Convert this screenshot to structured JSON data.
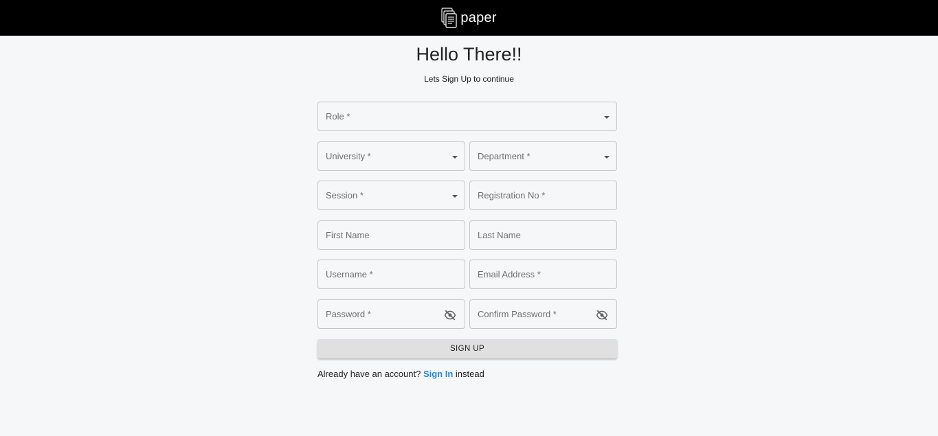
{
  "header": {
    "brand": "paper",
    "logo_icon": "document-stack-icon"
  },
  "hero": {
    "title": "Hello There!!",
    "subtitle": "Lets Sign Up to continue"
  },
  "form": {
    "role": {
      "label": "Role *",
      "value": ""
    },
    "university": {
      "label": "University *",
      "value": ""
    },
    "department": {
      "label": "Department *",
      "value": ""
    },
    "session": {
      "label": "Session *",
      "value": ""
    },
    "registration_no": {
      "label": "Registration No *",
      "value": ""
    },
    "first_name": {
      "label": "First Name",
      "value": ""
    },
    "last_name": {
      "label": "Last Name",
      "value": ""
    },
    "username": {
      "label": "Username *",
      "value": ""
    },
    "email": {
      "label": "Email Address *",
      "value": ""
    },
    "password": {
      "label": "Password *",
      "value": "",
      "toggle_icon": "eye-off-icon"
    },
    "confirm_password": {
      "label": "Confirm Password *",
      "value": "",
      "toggle_icon": "eye-off-icon"
    },
    "submit_label": "SIGN UP"
  },
  "footer": {
    "prefix": "Already have an account?",
    "link": "Sign In",
    "suffix": "instead"
  },
  "colors": {
    "topbar": "#000000",
    "background": "#f6f7f9",
    "link": "#1e88e5",
    "button": "#e0e0e0"
  }
}
